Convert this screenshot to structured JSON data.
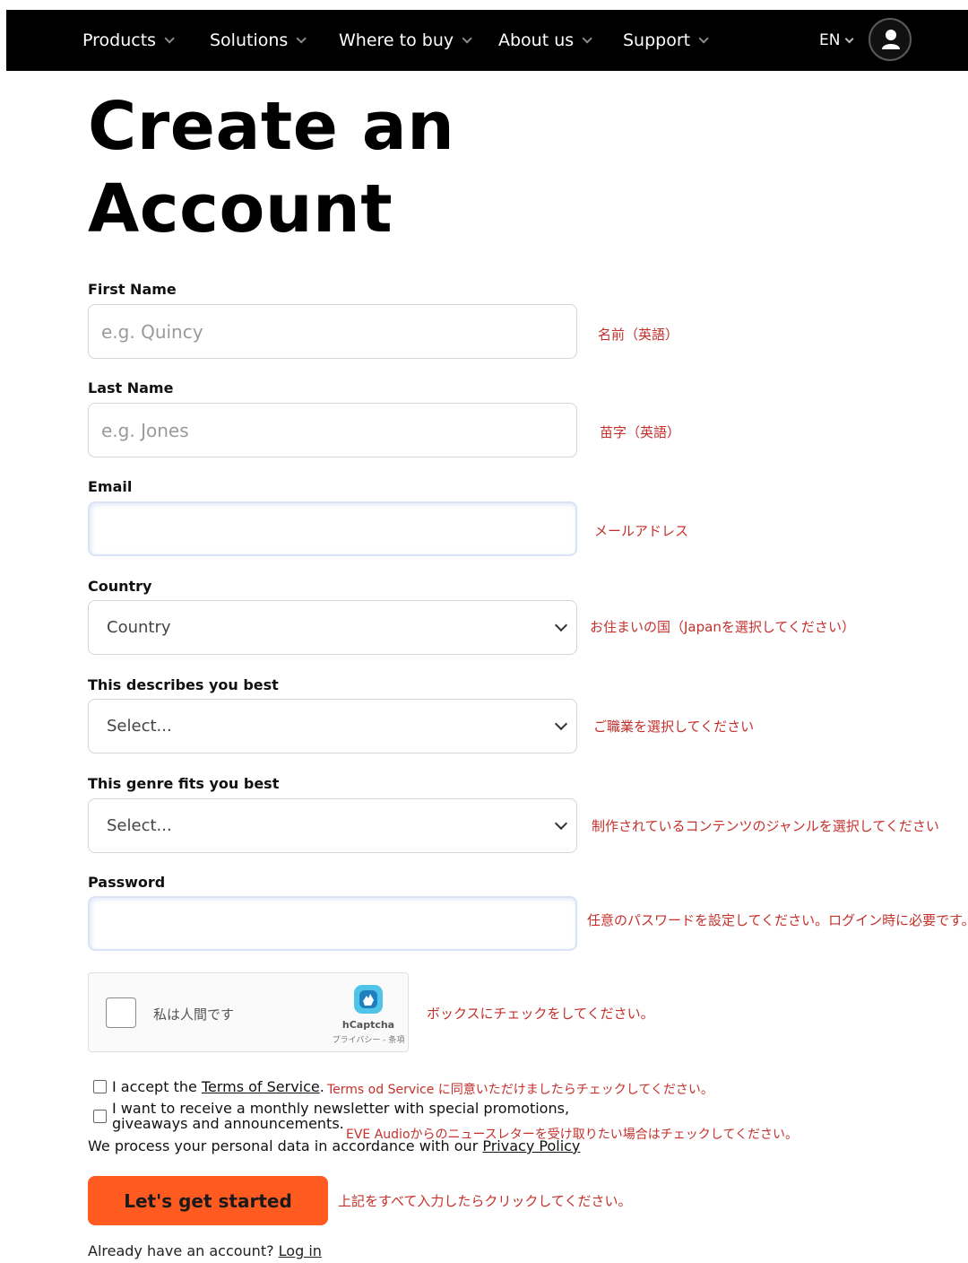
{
  "nav": {
    "items": [
      {
        "label": "Products"
      },
      {
        "label": "Solutions"
      },
      {
        "label": "Where to buy"
      },
      {
        "label": "About us"
      },
      {
        "label": "Support"
      }
    ],
    "language": "EN"
  },
  "page": {
    "title_line1": "Create an",
    "title_line2": "Account"
  },
  "form": {
    "first_name": {
      "label": "First Name",
      "placeholder": "e.g. Quincy",
      "note": "名前（英語）"
    },
    "last_name": {
      "label": "Last Name",
      "placeholder": "e.g. Jones",
      "note": "苗字（英語）"
    },
    "email": {
      "label": "Email",
      "value": "",
      "note": "メールアドレス"
    },
    "country": {
      "label": "Country",
      "selected": "Country",
      "note": "お住まいの国（Japanを選択してください）"
    },
    "describes": {
      "label": "This describes you best",
      "selected": "Select...",
      "note": "ご職業を選択してください"
    },
    "genre": {
      "label": "This genre fits you best",
      "selected": "Select...",
      "note": "制作されているコンテンツのジャンルを選択してください"
    },
    "password": {
      "label": "Password",
      "value": "",
      "note": "任意のパスワードを設定してください。ログイン時に必要です。"
    }
  },
  "captcha": {
    "text": "私は人間です",
    "brand": "hCaptcha",
    "links": "プライバシー - 条項",
    "note": "ボックスにチェックをしてください。"
  },
  "terms": {
    "prefix": "I accept the ",
    "link": "Terms of Service",
    "suffix": ".",
    "note": "Terms od Service に同意いただけましたらチェックしてください。"
  },
  "newsletter": {
    "line1": "I want to receive a monthly newsletter with special promotions,",
    "line2": "giveaways and announcements.",
    "note": "EVE Audioからのニュースレターを受け取りたい場合はチェックしてください。"
  },
  "privacy": {
    "prefix": "We process your personal data in accordance with our ",
    "link": "Privacy Policy"
  },
  "cta": {
    "label": "Let's get started",
    "note": "上記をすべて入力したらクリックしてください。"
  },
  "login": {
    "prefix": "Already have an account? ",
    "link": "Log in"
  }
}
